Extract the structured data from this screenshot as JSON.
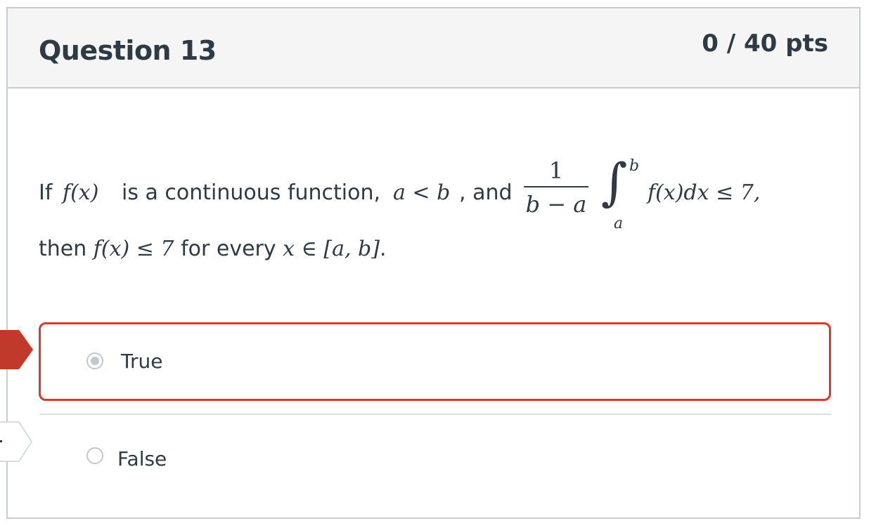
{
  "question": {
    "title": "Question 13",
    "points": "0 / 40 pts",
    "text": {
      "intro": "If",
      "f_of_x": "f(x)",
      "mid1": "is a continuous function,",
      "a_lt_b": "a < b",
      "mid2": ", and",
      "frac_num": "1",
      "frac_den": "b − a",
      "integral_sign": "∫",
      "upper_limit": "b",
      "lower_limit": "a",
      "integrand": "f(x)dx ≤ 7,",
      "then": "then",
      "conclusion": "f(x) ≤ 7",
      "for_every": "for every",
      "domain": "x ∈ [a, b]",
      "end": "."
    }
  },
  "answers": [
    {
      "label": "True",
      "selected": true,
      "status": "wrong"
    },
    {
      "label": "False",
      "selected": false,
      "status": "correct"
    }
  ],
  "colors": {
    "selected_border": "#e0392b",
    "wrong_marker": "#c0392b",
    "header_bg": "#f5f5f5",
    "text": "#2d3b45"
  }
}
